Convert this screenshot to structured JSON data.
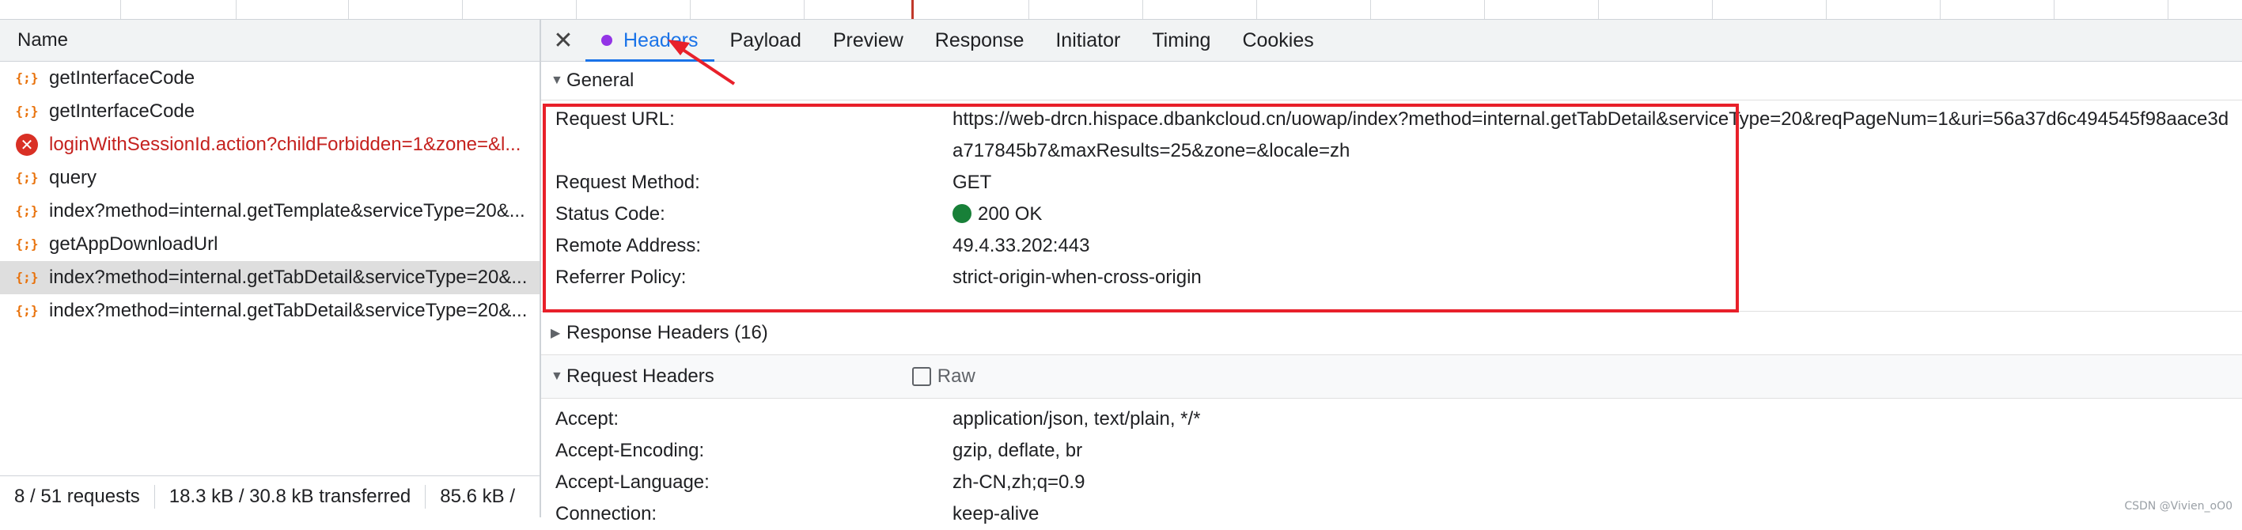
{
  "left": {
    "column_header": "Name",
    "requests": [
      {
        "name": "getInterfaceCode",
        "type": "fetch",
        "error": false,
        "selected": false
      },
      {
        "name": "getInterfaceCode",
        "type": "fetch",
        "error": false,
        "selected": false
      },
      {
        "name": "loginWithSessionId.action?childForbidden=1&zone=&l...",
        "type": "error",
        "error": true,
        "selected": false
      },
      {
        "name": "query",
        "type": "fetch",
        "error": false,
        "selected": false
      },
      {
        "name": "index?method=internal.getTemplate&serviceType=20&...",
        "type": "fetch",
        "error": false,
        "selected": false
      },
      {
        "name": "getAppDownloadUrl",
        "type": "fetch",
        "error": false,
        "selected": false
      },
      {
        "name": "index?method=internal.getTabDetail&serviceType=20&...",
        "type": "fetch",
        "error": false,
        "selected": true
      },
      {
        "name": "index?method=internal.getTabDetail&serviceType=20&...",
        "type": "fetch",
        "error": false,
        "selected": false
      }
    ],
    "status": {
      "requests": "8 / 51 requests",
      "transferred": "18.3 kB / 30.8 kB transferred",
      "resources": "85.6 kB /"
    }
  },
  "tabs": {
    "close_icon": "close-icon",
    "items": [
      "Headers",
      "Payload",
      "Preview",
      "Response",
      "Initiator",
      "Timing",
      "Cookies"
    ],
    "active": "Headers"
  },
  "general": {
    "title": "General",
    "rows": [
      {
        "key": "Request URL:",
        "value": "https://web-drcn.hispace.dbankcloud.cn/uowap/index?method=internal.getTabDetail&serviceType=20&reqPageNum=1&uri=56a37d6c494545f98aace3da717845b7&maxResults=25&zone=&locale=zh"
      },
      {
        "key": "Request Method:",
        "value": "GET"
      },
      {
        "key": "Status Code:",
        "value": "200 OK"
      },
      {
        "key": "Remote Address:",
        "value": "49.4.33.202:443"
      },
      {
        "key": "Referrer Policy:",
        "value": "strict-origin-when-cross-origin"
      }
    ]
  },
  "response_headers": {
    "title": "Response Headers (16)"
  },
  "request_headers": {
    "title": "Request Headers",
    "raw_label": "Raw",
    "rows": [
      {
        "key": "Accept:",
        "value": "application/json, text/plain, */*"
      },
      {
        "key": "Accept-Encoding:",
        "value": "gzip, deflate, br"
      },
      {
        "key": "Accept-Language:",
        "value": "zh-CN,zh;q=0.9"
      },
      {
        "key": "Connection:",
        "value": "keep-alive"
      }
    ]
  },
  "colors": {
    "active_tab": "#1a73e8",
    "status_ok": "#188038",
    "error": "#d93025",
    "highlight": "#e8202a",
    "headers_dot": "#9334e6"
  },
  "watermark": "CSDN @Vivien_oO0"
}
